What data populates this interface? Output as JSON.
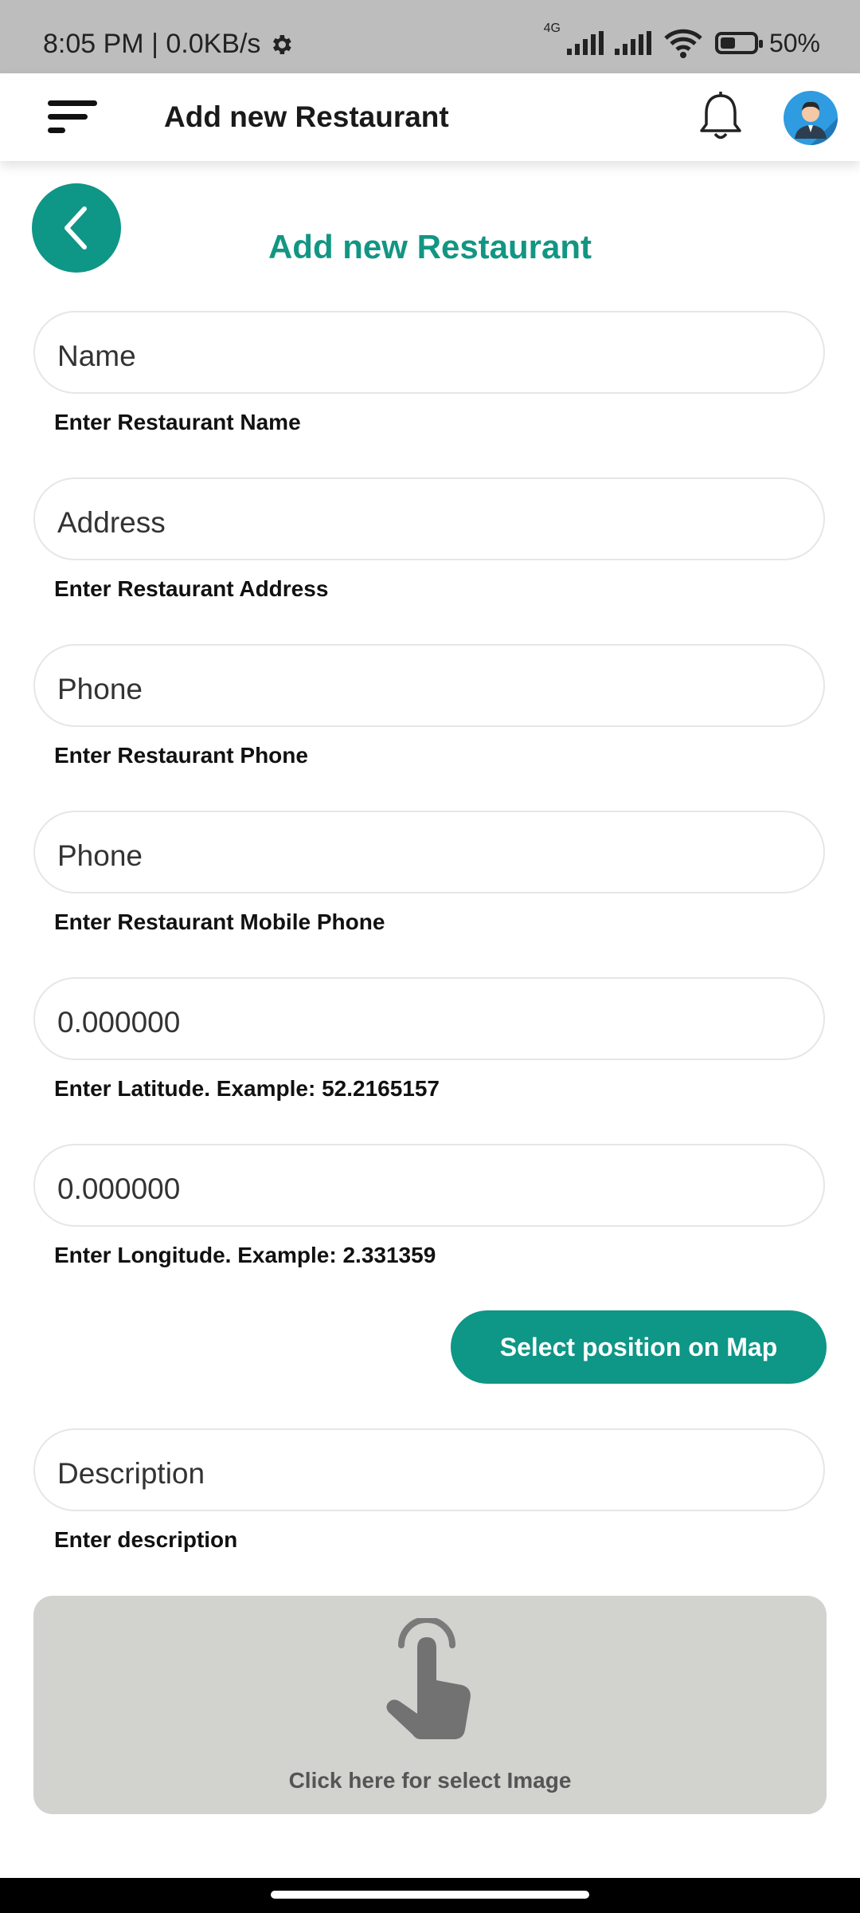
{
  "status_bar": {
    "time_and_speed": "8:05 PM | 0.0KB/s",
    "network_label": "4G",
    "battery_percent": "50%"
  },
  "app_bar": {
    "title": "Add new Restaurant"
  },
  "page": {
    "title": "Add new Restaurant"
  },
  "form": {
    "fields": [
      {
        "placeholder": "Name",
        "hint": "Enter Restaurant Name"
      },
      {
        "placeholder": "Address",
        "hint": "Enter Restaurant Address"
      },
      {
        "placeholder": "Phone",
        "hint": "Enter Restaurant Phone"
      },
      {
        "placeholder": "Phone",
        "hint": "Enter Restaurant Mobile Phone"
      },
      {
        "placeholder": "0.000000",
        "hint": "Enter Latitude. Example: 52.2165157"
      },
      {
        "placeholder": "0.000000",
        "hint": "Enter Longitude. Example: 2.331359"
      },
      {
        "placeholder": "Description",
        "hint": "Enter description"
      }
    ],
    "map_button_label": "Select position on Map",
    "image_select_label": "Click here for select Image"
  },
  "colors": {
    "accent": "#0e9686",
    "title_accent": "#129683",
    "status_bar": "#bdbdbd",
    "image_box": "#d2d2cf"
  },
  "icons": [
    "gear-icon",
    "signal-icon",
    "wifi-icon",
    "battery-icon",
    "menu-icon",
    "bell-icon",
    "avatar",
    "chevron-left-icon",
    "touch-hand-icon"
  ]
}
